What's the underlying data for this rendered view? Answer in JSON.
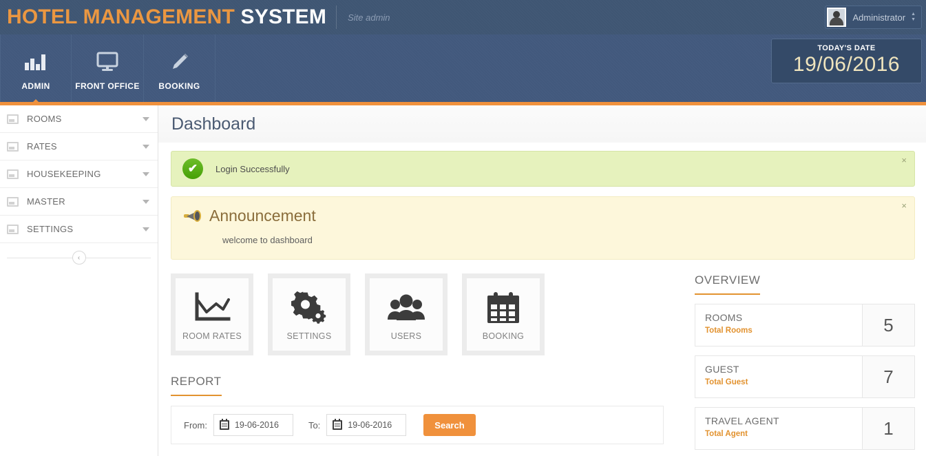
{
  "topbar": {
    "brand_part1": "HOTEL MANAGEMENT",
    "brand_part2": "SYSTEM",
    "site_admin": "Site admin",
    "user_name": "Administrator"
  },
  "nav": {
    "tabs": [
      {
        "label": "ADMIN",
        "icon": "bar-chart-icon",
        "active": true
      },
      {
        "label": "FRONT OFFICE",
        "icon": "monitor-icon",
        "active": false
      },
      {
        "label": "BOOKING",
        "icon": "pencil-icon",
        "active": false
      }
    ],
    "date_label": "TODAY'S DATE",
    "date_value": "19/06/2016"
  },
  "sidebar": {
    "items": [
      {
        "label": "ROOMS"
      },
      {
        "label": "RATES"
      },
      {
        "label": "HOUSEKEEPING"
      },
      {
        "label": "MASTER"
      },
      {
        "label": "SETTINGS"
      }
    ],
    "collapse_glyph": "‹"
  },
  "page": {
    "title": "Dashboard"
  },
  "alerts": {
    "success": {
      "text": "Login Successfully",
      "close": "×",
      "check": "✔"
    },
    "announcement": {
      "title": "Announcement",
      "body": "welcome to dashboard",
      "close": "×"
    }
  },
  "tiles": [
    {
      "label": "ROOM RATES",
      "icon": "line-chart-icon"
    },
    {
      "label": "SETTINGS",
      "icon": "gears-icon"
    },
    {
      "label": "USERS",
      "icon": "users-icon"
    },
    {
      "label": "BOOKING",
      "icon": "calendar-icon"
    }
  ],
  "report": {
    "heading": "REPORT",
    "from_label": "From:",
    "from_value": "19-06-2016",
    "to_label": "To:",
    "to_value": "19-06-2016",
    "search_label": "Search"
  },
  "overview": {
    "heading": "OVERVIEW",
    "cards": [
      {
        "title": "ROOMS",
        "subtitle": "Total Rooms",
        "value": "5"
      },
      {
        "title": "GUEST",
        "subtitle": "Total Guest",
        "value": "7"
      },
      {
        "title": "TRAVEL AGENT",
        "subtitle": "Total Agent",
        "value": "1"
      }
    ]
  },
  "colors": {
    "accent_orange": "#f0913c",
    "nav_blue": "#42597d",
    "brand_orange": "#eb9741",
    "success_bg": "#e6f2bd",
    "warning_bg": "#fdf7db"
  }
}
